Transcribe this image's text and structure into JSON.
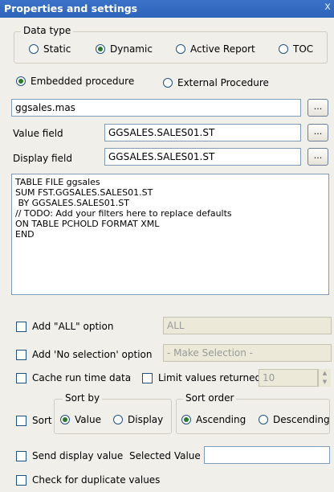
{
  "window": {
    "title": "Properties and settings",
    "close_glyph": "x"
  },
  "data_type": {
    "legend": "Data type",
    "options": [
      {
        "label": "Static",
        "selected": false
      },
      {
        "label": "Dynamic",
        "selected": true
      },
      {
        "label": "Active Report",
        "selected": false
      },
      {
        "label": "TOC",
        "selected": false
      }
    ]
  },
  "procedure": {
    "options": [
      {
        "label": "Embedded procedure",
        "selected": true
      },
      {
        "label": "External Procedure",
        "selected": false
      }
    ]
  },
  "procedure_file": {
    "value": "ggsales.mas",
    "browse_label": "..."
  },
  "value_field": {
    "label": "Value field",
    "value": "GGSALES.SALES01.ST",
    "browse_label": "..."
  },
  "display_field": {
    "label": "Display field",
    "value": "GGSALES.SALES01.ST",
    "browse_label": "..."
  },
  "procedure_text": {
    "lines": [
      "TABLE FILE ggsales",
      "SUM FST.GGSALES.SALES01.ST",
      " BY GGSALES.SALES01.ST",
      "// TODO: Add your filters here to replace defaults",
      "ON TABLE PCHOLD FORMAT XML",
      "END"
    ]
  },
  "add_all": {
    "label": "Add \"ALL\" option",
    "checked": false,
    "value": "ALL"
  },
  "add_no_selection": {
    "label": "Add 'No selection' option",
    "checked": false,
    "value": "- Make Selection -"
  },
  "cache_run_time": {
    "label": "Cache run time data",
    "checked": false
  },
  "limit_values": {
    "label": "Limit values returned",
    "checked": false,
    "value": "10",
    "spin_up": "▲",
    "spin_down": "▼"
  },
  "sort": {
    "label": "Sort",
    "checked": false
  },
  "sort_by": {
    "legend": "Sort by",
    "options": [
      {
        "label": "Value",
        "selected": true
      },
      {
        "label": "Display",
        "selected": false
      }
    ]
  },
  "sort_order": {
    "legend": "Sort order",
    "options": [
      {
        "label": "Ascending",
        "selected": true
      },
      {
        "label": "Descending",
        "selected": false
      }
    ]
  },
  "send_display_value": {
    "label": "Send display value",
    "checked": false
  },
  "selected_value": {
    "label": "Selected Value",
    "value": ""
  },
  "check_duplicates": {
    "label": "Check for duplicate values",
    "checked": false
  }
}
